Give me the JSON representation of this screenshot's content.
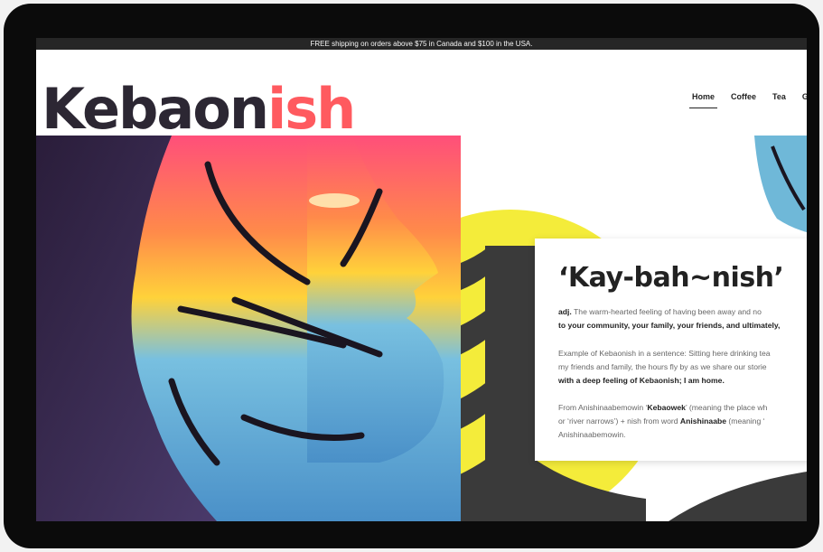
{
  "announcement": "FREE shipping on orders above $75 in Canada and $100 in the USA.",
  "brand": {
    "part1": "Kebaon",
    "part2": "ish"
  },
  "nav": {
    "items": [
      "Home",
      "Coffee",
      "Tea",
      "G"
    ],
    "active": "Home"
  },
  "card": {
    "title": "‘Kay-bah~nish’",
    "p1_prefix": "adj.",
    "p1_line1": " The warm-hearted feeling of having been away and no",
    "p1_line2": "to your community, your family, your friends, and ultimately,",
    "p2_line1": "Example of Kebaonish in a sentence: Sitting here drinking tea",
    "p2_line2": "my friends and family, the hours fly by as we share our storie",
    "p2_line3": "with a deep feeling of Kebaonish; I am home.",
    "p3_line1_pre": "From Anishinaabemowin ‘",
    "p3_line1_bold": "Kebaowek",
    "p3_line1_post": "’ (meaning the place wh",
    "p3_line2_pre": "or ‘river narrows’) + nish from word ",
    "p3_line2_bold": "Anishinaabe",
    "p3_line2_post": " (meaning ‘",
    "p3_line3": "Anishinaabemowin."
  },
  "colors": {
    "brand_dark": "#2c2733",
    "brand_accent": "#ff5a5f",
    "yellow": "#f4ec3a",
    "tree": "#3a3a3a"
  }
}
